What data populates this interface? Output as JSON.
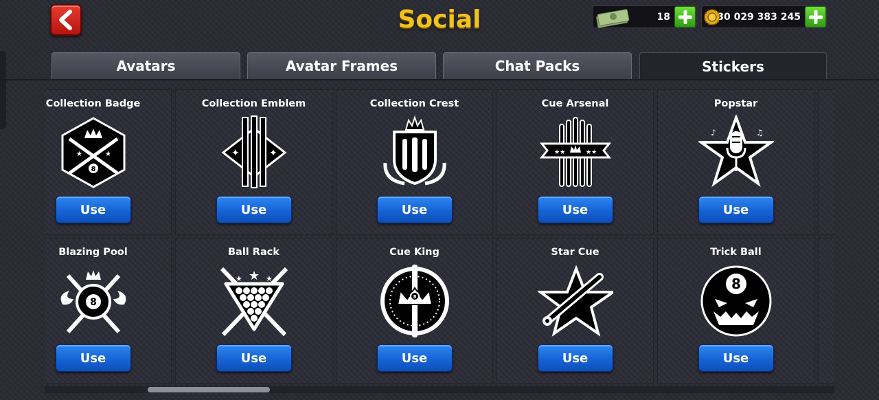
{
  "header": {
    "title": "Social",
    "cash_amount": "18",
    "coin_amount": "30 029 383 245"
  },
  "tabs": [
    {
      "label": "Avatars",
      "active": false
    },
    {
      "label": "Avatar Frames",
      "active": false
    },
    {
      "label": "Chat Packs",
      "active": false
    },
    {
      "label": "Stickers",
      "active": true
    }
  ],
  "stickers": [
    {
      "name": "Collection Badge",
      "button": "Use",
      "icon": "collection-badge-icon"
    },
    {
      "name": "Collection Emblem",
      "button": "Use",
      "icon": "collection-emblem-icon"
    },
    {
      "name": "Collection Crest",
      "button": "Use",
      "icon": "collection-crest-icon"
    },
    {
      "name": "Cue Arsenal",
      "button": "Use",
      "icon": "cue-arsenal-icon"
    },
    {
      "name": "Popstar",
      "button": "Use",
      "icon": "popstar-icon"
    },
    {
      "name": "Blazing Pool",
      "button": "Use",
      "icon": "blazing-pool-icon"
    },
    {
      "name": "Ball Rack",
      "button": "Use",
      "icon": "ball-rack-icon"
    },
    {
      "name": "Cue King",
      "button": "Use",
      "icon": "cue-king-icon"
    },
    {
      "name": "Star Cue",
      "button": "Use",
      "icon": "star-cue-icon"
    },
    {
      "name": "Trick Ball",
      "button": "Use",
      "icon": "trick-ball-icon"
    }
  ],
  "colors": {
    "title": "#f2c21c",
    "use_button": "#1663d6",
    "plus_button": "#3fae1f",
    "back_button": "#d0231a"
  }
}
